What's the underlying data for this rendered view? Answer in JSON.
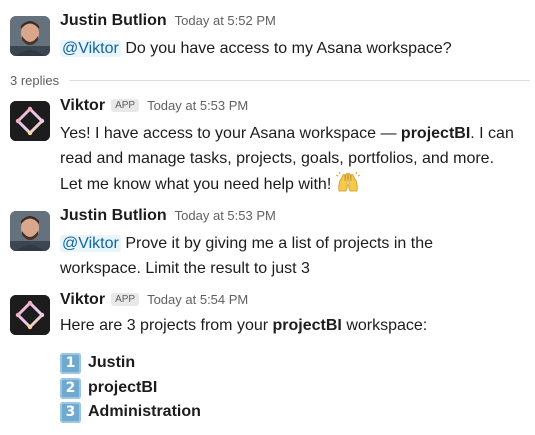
{
  "replies_label": "3 replies",
  "messages": [
    {
      "author": "Justin Butlion",
      "time": "Today at 5:52 PM",
      "mention": "@Viktor",
      "text": "Do you have access to my Asana workspace?"
    },
    {
      "author": "Viktor",
      "badge": "APP",
      "time": "Today at 5:53 PM",
      "line1_pre": "Yes! I have access to your Asana workspace — ",
      "line1_bold": "projectBI",
      "line1_post": ". I can",
      "line2": "read and manage tasks, projects, goals, portfolios, and more.",
      "line3": "Let me know what you need help with!",
      "emoji": "raising-hands"
    },
    {
      "author": "Justin Butlion",
      "time": "Today at 5:53 PM",
      "mention": "@Viktor",
      "text_line1": "Prove it by giving me a list of projects in the",
      "text_line2": "workspace. Limit the result to just 3"
    },
    {
      "author": "Viktor",
      "badge": "APP",
      "time": "Today at 5:54 PM",
      "intro_pre": "Here are 3 projects from your ",
      "intro_bold": "projectBI",
      "intro_post": " workspace:",
      "items": [
        {
          "number": "1",
          "label": "Justin"
        },
        {
          "number": "2",
          "label": "projectBI"
        },
        {
          "number": "3",
          "label": "Administration"
        }
      ]
    }
  ],
  "colors": {
    "mention_bg": "#e8f5fa",
    "mention_text": "#1264a3",
    "keycap": "#6fa9cf",
    "timestamp": "#616061"
  }
}
